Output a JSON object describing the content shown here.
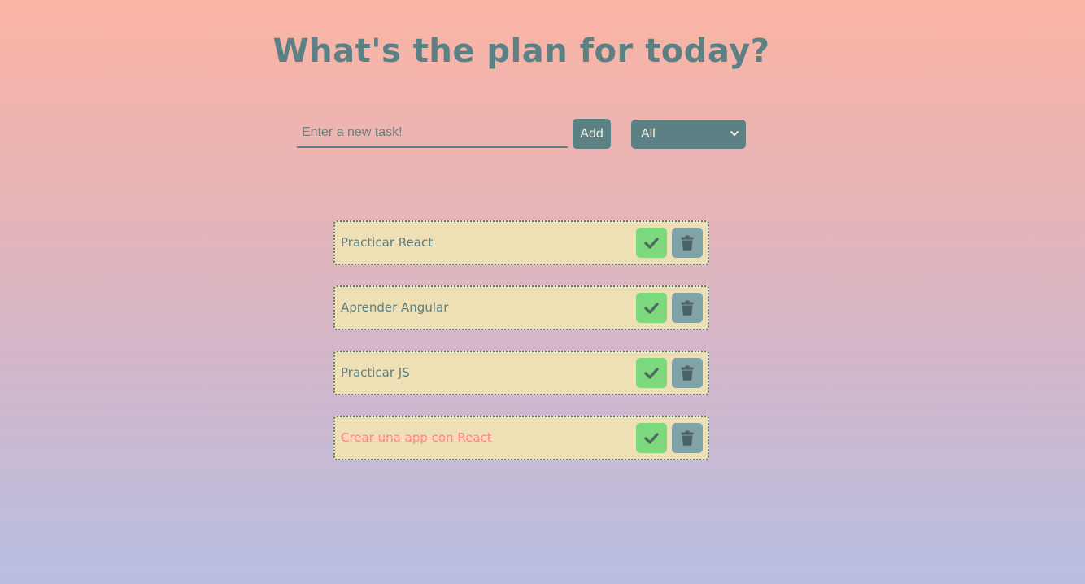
{
  "header": {
    "title": "What's the plan for today?"
  },
  "form": {
    "input_placeholder": "Enter a new task!",
    "input_value": "",
    "add_label": "Add",
    "filter_selected": "All",
    "filter_options": [
      "All"
    ]
  },
  "todos": [
    {
      "text": "Practicar React",
      "completed": false
    },
    {
      "text": "Aprender Angular",
      "completed": false
    },
    {
      "text": "Practicar JS",
      "completed": false
    },
    {
      "text": "Crear una app con React",
      "completed": true
    }
  ],
  "icons": {
    "check": "check-icon",
    "delete": "trash-icon",
    "dropdown": "chevron-down-icon"
  },
  "colors": {
    "primary": "#5b8185",
    "todo_bg": "#eedfb5",
    "check_bg": "#7cd97c",
    "delete_bg": "#7fa3a6",
    "completed_text": "#f08a82"
  }
}
